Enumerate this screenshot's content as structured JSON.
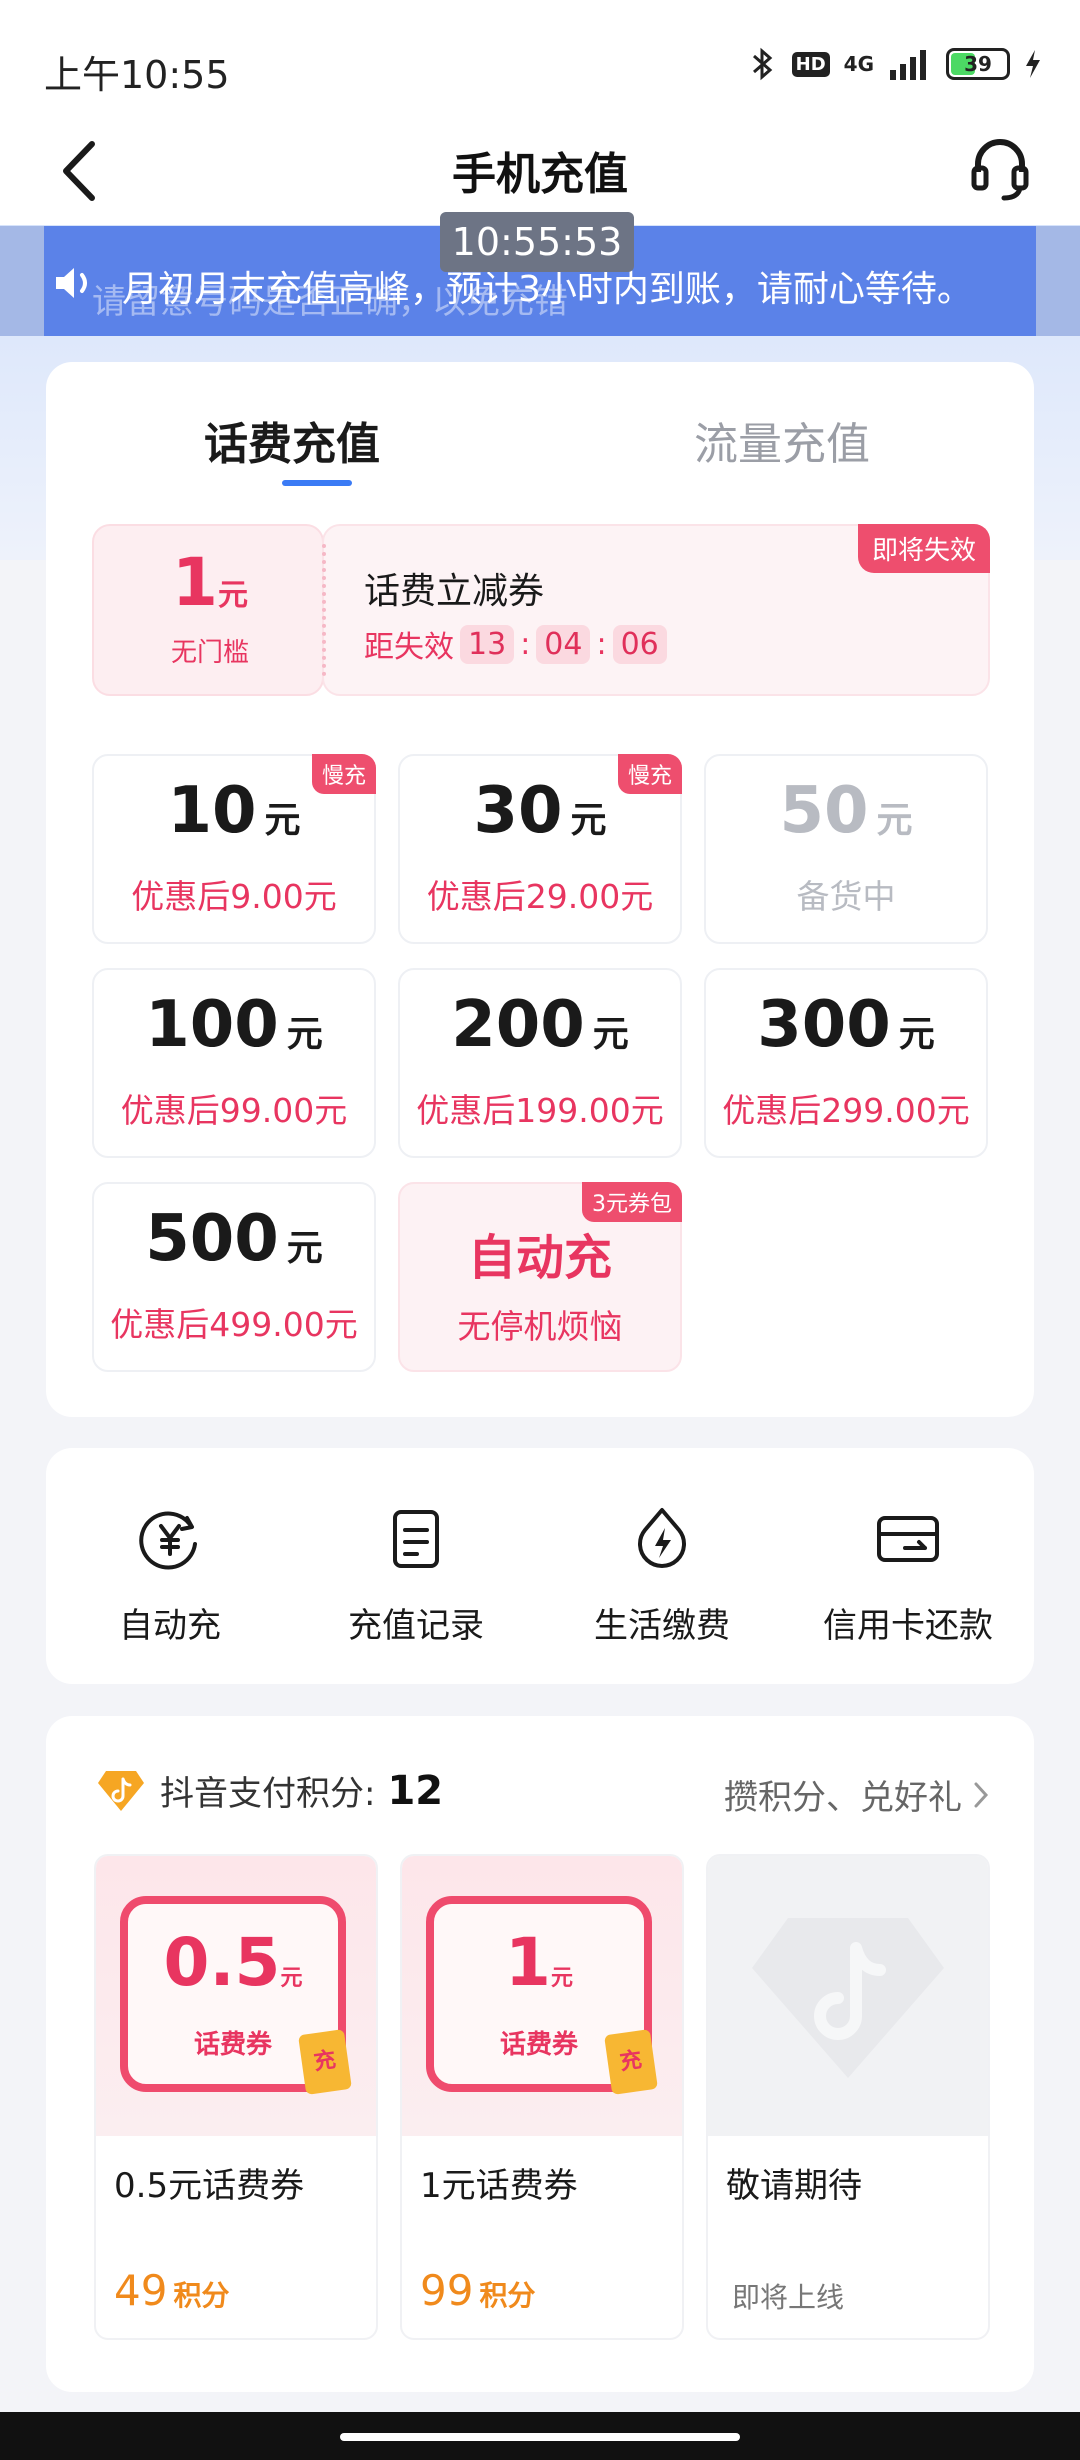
{
  "status_bar": {
    "time": "上午10:55",
    "network": "4G",
    "hd": "HD",
    "battery": "39"
  },
  "nav": {
    "title": "手机充值"
  },
  "overlay_clock": "10:55:53",
  "notice": {
    "text": "月初月末充值高峰，预计3小时内到账，请耐心等待。",
    "ghost_text": "请留意号码是否正确，以免充错"
  },
  "tabs": [
    {
      "label": "话费充值",
      "active": true
    },
    {
      "label": "流量充值",
      "active": false
    }
  ],
  "coupon": {
    "amount": "1",
    "unit": "元",
    "condition": "无门槛",
    "title": "话费立减券",
    "countdown_label": "距失效",
    "hours": "13",
    "minutes": "04",
    "seconds": "06",
    "tag": "即将失效"
  },
  "prices": [
    {
      "amount": "10",
      "unit": "元",
      "sub": "优惠后9.00元",
      "badge": "慢充"
    },
    {
      "amount": "30",
      "unit": "元",
      "sub": "优惠后29.00元",
      "badge": "慢充"
    },
    {
      "amount": "50",
      "unit": "元",
      "sub": "备货中",
      "badge": ""
    },
    {
      "amount": "100",
      "unit": "元",
      "sub": "优惠后99.00元",
      "badge": ""
    },
    {
      "amount": "200",
      "unit": "元",
      "sub": "优惠后199.00元",
      "badge": ""
    },
    {
      "amount": "300",
      "unit": "元",
      "sub": "优惠后299.00元",
      "badge": ""
    },
    {
      "amount": "500",
      "unit": "元",
      "sub": "优惠后499.00元",
      "badge": ""
    }
  ],
  "auto_recharge": {
    "title": "自动充",
    "sub": "无停机烦恼",
    "badge": "3元券包"
  },
  "actions": [
    {
      "label": "自动充",
      "icon": "yuan-cycle-icon"
    },
    {
      "label": "充值记录",
      "icon": "document-icon"
    },
    {
      "label": "生活缴费",
      "icon": "lightning-drop-icon"
    },
    {
      "label": "信用卡还款",
      "icon": "credit-card-icon"
    }
  ],
  "points": {
    "label": "抖音支付积分:",
    "value": "12",
    "link": "攒积分、兑好礼"
  },
  "gifts": [
    {
      "value": "0.5",
      "unit": "元",
      "caption": "话费券",
      "chip": "充",
      "name": "0.5元话费券",
      "cost": "49",
      "cost_unit": "积分"
    },
    {
      "value": "1",
      "unit": "元",
      "caption": "话费券",
      "chip": "充",
      "name": "1元话费券",
      "cost": "99",
      "cost_unit": "积分"
    },
    {
      "name": "敬请期待",
      "status": "即将上线"
    }
  ]
}
